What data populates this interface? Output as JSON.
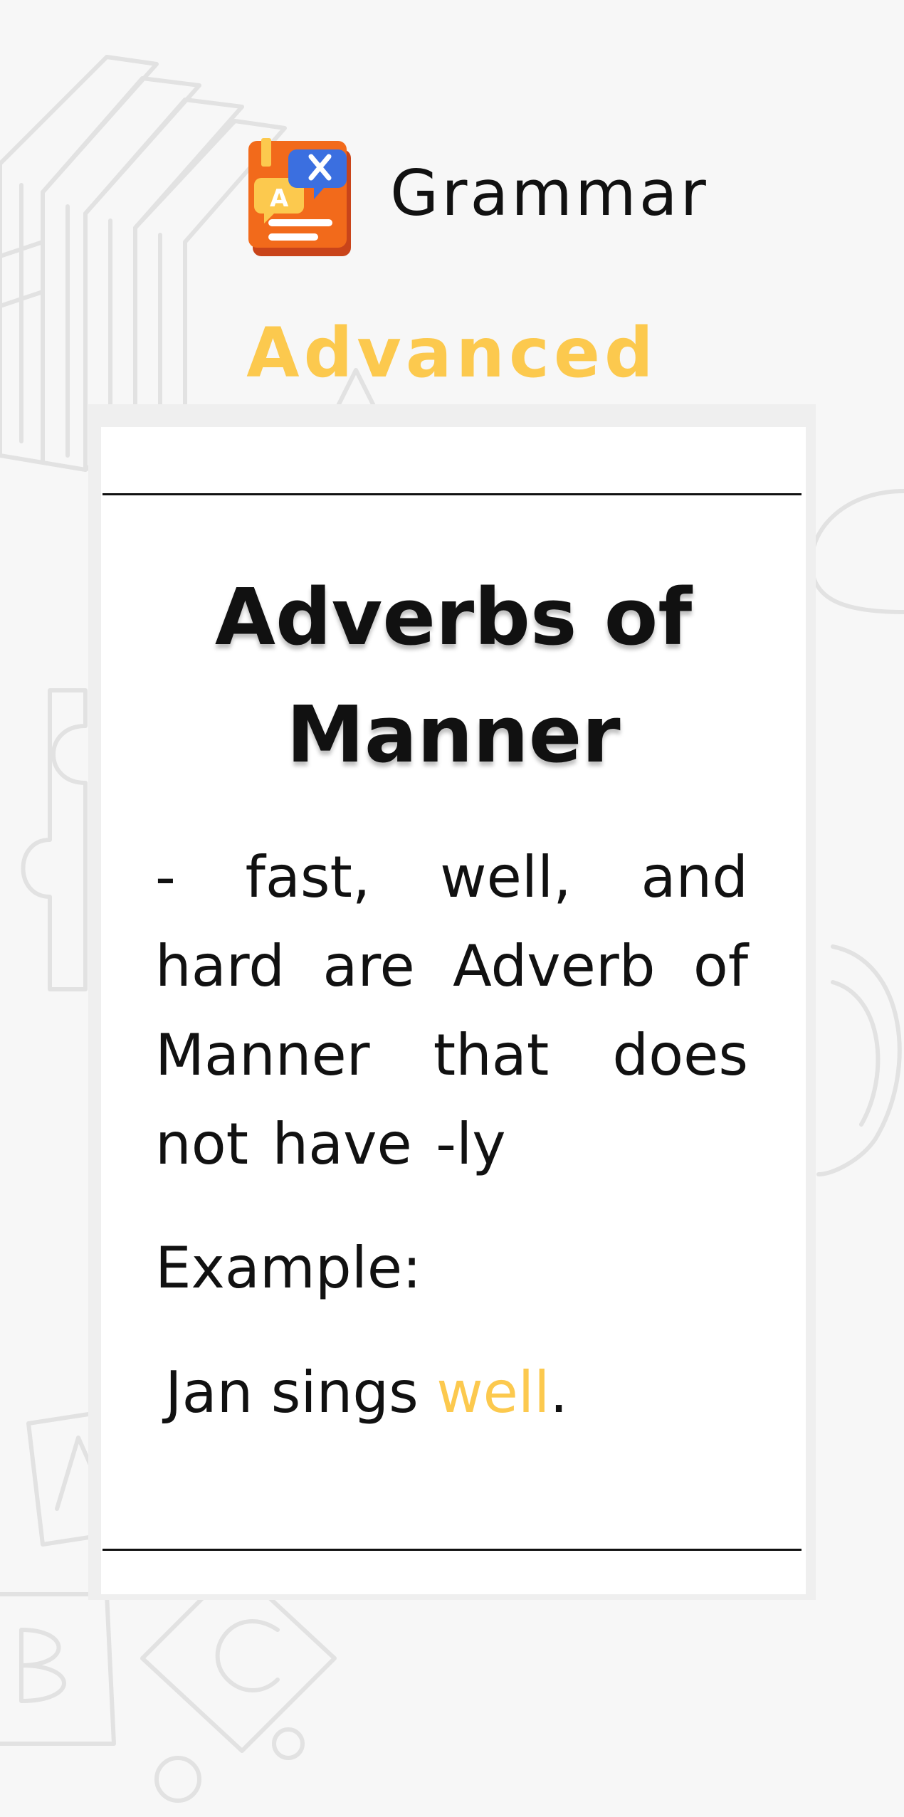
{
  "app": {
    "title": "Grammar",
    "icon": "grammar-book-icon",
    "level": "Advanced"
  },
  "colors": {
    "accent": "#fcc94e",
    "icon_orange": "#f26a1b",
    "text": "#111111",
    "background": "#f7f7f7",
    "card": "#ffffff"
  },
  "lesson": {
    "title_line1": "Adverbs of",
    "title_line2": "Manner",
    "description": " -   fast, well, and hard are  Adverb of Manner that does not have -ly",
    "example_label": "Example:",
    "example": {
      "before": "Jan sings ",
      "highlight": "well",
      "after": "."
    }
  }
}
